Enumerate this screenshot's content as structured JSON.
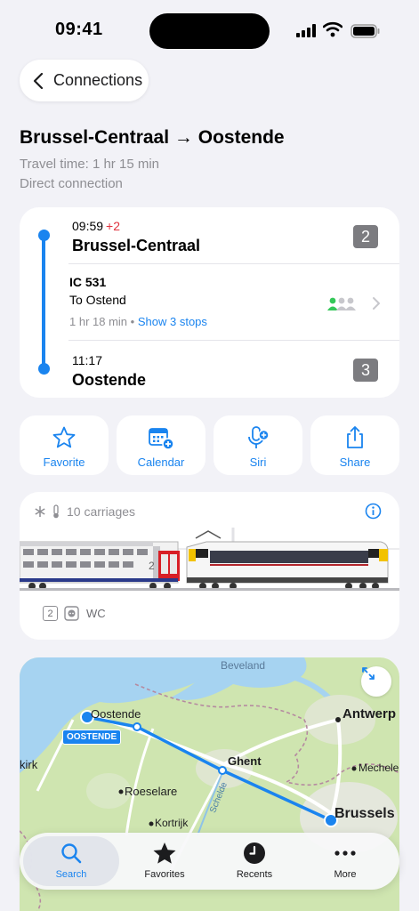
{
  "status": {
    "time": "09:41"
  },
  "nav": {
    "back_label": "Connections"
  },
  "header": {
    "title": "Brussel-Centraal → Oostende",
    "travel_time": "Travel time: 1 hr 15 min",
    "connection_type": "Direct connection"
  },
  "journey": {
    "departure": {
      "time": "09:59",
      "delay": "+2",
      "station": "Brussel-Centraal",
      "platform": "2"
    },
    "train": {
      "name": "IC 531",
      "direction": "To Ostend",
      "duration": "1 hr 18 min",
      "separator": "•",
      "stops_link": "Show 3 stops"
    },
    "arrival": {
      "time": "11:17",
      "station": "Oostende",
      "platform": "3"
    }
  },
  "actions": [
    {
      "label": "Favorite",
      "icon": "star-icon"
    },
    {
      "label": "Calendar",
      "icon": "calendar-add-icon"
    },
    {
      "label": "Siri",
      "icon": "siri-mic-icon"
    },
    {
      "label": "Share",
      "icon": "share-icon"
    }
  ],
  "composition": {
    "carriages": "10 carriages",
    "car_number": "2",
    "class_badge": "2",
    "wc_label": "WC",
    "icons": [
      "snowflake-icon",
      "thermometer-icon",
      "info-icon",
      "power-outlet-icon"
    ]
  },
  "map": {
    "labels": {
      "beveland": "Beveland",
      "oostende": "Oostende",
      "oostende_pill": "OOSTENDE",
      "antwerp": "Antwerp",
      "ghent": "Ghent",
      "kirk": "kirk",
      "mechelen": "Mecheler",
      "roeselare": "Roeselare",
      "kortrijk": "Kortrijk",
      "brussels": "Brussels",
      "schelde": "Schelde"
    }
  },
  "tabs": [
    {
      "label": "Search",
      "active": true
    },
    {
      "label": "Favorites",
      "active": false
    },
    {
      "label": "Recents",
      "active": false
    },
    {
      "label": "More",
      "active": false
    }
  ],
  "colors": {
    "accent": "#1a84ef",
    "delay": "#e0323e",
    "platform_badge": "#7c7c80",
    "background": "#f2f2f7"
  }
}
